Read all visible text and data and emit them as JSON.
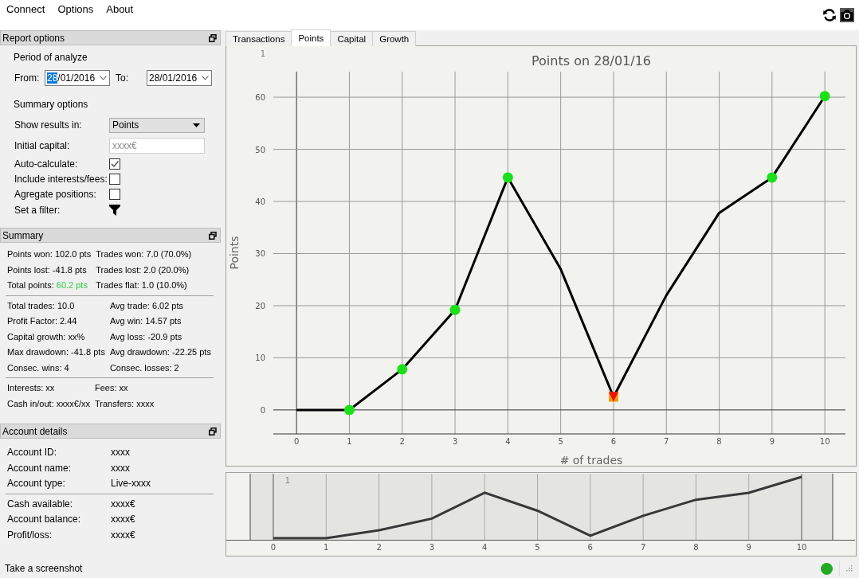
{
  "menu": [
    {
      "label": "Connect"
    },
    {
      "label": "Options"
    },
    {
      "label": "About"
    }
  ],
  "toolbar": [
    {
      "kind": "refresh"
    },
    {
      "kind": "camera"
    }
  ],
  "report_options": {
    "title": "Report options",
    "period_heading": "Period of analyze",
    "from": {
      "label": "From:",
      "value": "28/01/2016",
      "focused": true
    },
    "to": {
      "label": "To:",
      "value": "28/01/2016",
      "focused": false
    },
    "summary_heading": "Summary options",
    "fields": [
      {
        "kind": "select",
        "label": "Show results in:",
        "value": "Points"
      },
      {
        "kind": "text",
        "label": "Initial capital:",
        "placeholder": "xxxx€"
      },
      {
        "kind": "checkbox",
        "label": "Auto-calculate:",
        "checked": true
      },
      {
        "kind": "checkbox",
        "label": "Include interests/fees:",
        "checked": false
      },
      {
        "kind": "checkbox",
        "label": "Agregate positions:",
        "checked": false
      },
      {
        "kind": "filter",
        "label": "Set a filter:"
      }
    ]
  },
  "summary": {
    "title": "Summary",
    "groups": [
      [
        {
          "label": "Points won:",
          "value": "102.0 pts"
        },
        {
          "label": "Trades won:",
          "value": "7.0 (70.0%)"
        },
        {
          "label": "Points lost:",
          "value": "-41.8 pts"
        },
        {
          "label": "Trades lost:",
          "value": "2.0 (20.0%)"
        },
        {
          "label": "Total points:",
          "value": "60.2 pts",
          "color": "#2ecc40"
        },
        {
          "label": "Trades flat:",
          "value": "1.0 (10.0%)"
        }
      ],
      [
        {
          "label": "Total trades:",
          "value": "10.0"
        },
        {
          "label": "Avg trade:",
          "value": "6.02 pts"
        },
        {
          "label": "Profit Factor:",
          "value": "2.44"
        },
        {
          "label": "Avg win:",
          "value": "14.57 pts"
        },
        {
          "label": "Capital growth:",
          "value": "xx%"
        },
        {
          "label": "Avg loss:",
          "value": "-20.9 pts"
        },
        {
          "label": "Max drawdown:",
          "value": "-41.8 pts"
        },
        {
          "label": "Avg drawdown:",
          "value": "-22.25 pts"
        },
        {
          "label": "Consec. wins:",
          "value": "4"
        },
        {
          "label": "Consec. losses:",
          "value": "2"
        }
      ],
      [
        {
          "label": "Interests:",
          "value": "xx"
        },
        {
          "label": "Fees:",
          "value": "xx"
        },
        {
          "label": "Cash in/out:",
          "value": "xxxx€/xx"
        },
        {
          "label": "Transfers:",
          "value": "xxxx"
        }
      ]
    ]
  },
  "account_details": {
    "title": "Account details",
    "groups": [
      [
        {
          "label": "Account ID:",
          "value": "xxxx"
        },
        {
          "label": "Account name:",
          "value": "xxxx"
        },
        {
          "label": "Account type:",
          "value": "Live-xxxx"
        }
      ],
      [
        {
          "label": "Cash available:",
          "value": "xxxx€"
        },
        {
          "label": "Account balance:",
          "value": "xxxx€"
        },
        {
          "label": "Profit/loss:",
          "value": "xxxx€"
        }
      ]
    ]
  },
  "tabs": [
    {
      "label": "Transactions",
      "selected": false
    },
    {
      "label": "Points",
      "selected": true
    },
    {
      "label": "Capital",
      "selected": false
    },
    {
      "label": "Growth",
      "selected": false
    }
  ],
  "points_chart": {
    "corner_label": "1",
    "chart_data": {
      "type": "line",
      "title": "Points on 28/01/16",
      "xlabel": "# of trades",
      "ylabel": "Points",
      "x": [
        0,
        1,
        2,
        3,
        4,
        5,
        6,
        7,
        8,
        9,
        10
      ],
      "grid": true,
      "series": [
        {
          "color": "#000000",
          "values": [
            0,
            0,
            7.8,
            19.2,
            44.6,
            27,
            2.5,
            22,
            37.8,
            44.6,
            60.2
          ]
        }
      ],
      "xlim": [
        -0.44,
        10.39
      ],
      "ylim": [
        -4.6,
        64.9
      ],
      "xticks": [
        0,
        1,
        2,
        3,
        4,
        5,
        6,
        7,
        8,
        9,
        10
      ],
      "yticks": [
        0,
        10,
        20,
        30,
        40,
        50,
        60
      ]
    },
    "point_markers": [
      {
        "kind": "plain"
      },
      {
        "kind": "win"
      },
      {
        "kind": "win"
      },
      {
        "kind": "win"
      },
      {
        "kind": "win"
      },
      {
        "kind": "plain"
      },
      {
        "kind": "loss"
      },
      {
        "kind": "plain"
      },
      {
        "kind": "plain"
      },
      {
        "kind": "win"
      },
      {
        "kind": "win"
      }
    ]
  },
  "overview": {
    "corner_label": "1",
    "xticks": [
      "0",
      "1",
      "2",
      "3",
      "4",
      "5",
      "6",
      "7",
      "8",
      "9",
      "10"
    ]
  },
  "status_bar": {
    "message": "Take a screenshot",
    "connected": true
  }
}
